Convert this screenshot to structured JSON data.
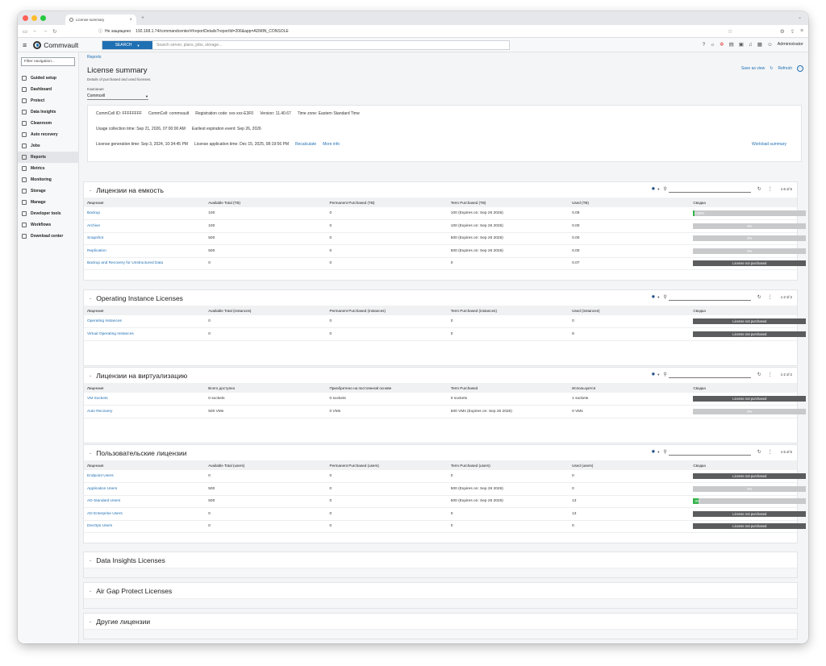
{
  "browser": {
    "tab_title": "License summary",
    "not_secure": "Не защищено",
    "url": "192.168.1.74/commandcenter/#/reportDetails?reportId=206&app=ADMIN_CONSOLE"
  },
  "header": {
    "logo": "Commvault",
    "search_button": "SEARCH",
    "search_placeholder": "Search server, plans, jobs, storage...",
    "user": "Administrator"
  },
  "sidebar": {
    "filter_placeholder": "Filter navigation...",
    "items": [
      {
        "label": "Guided setup",
        "icon": "compass-icon"
      },
      {
        "label": "Dashboard",
        "icon": "grid-icon"
      },
      {
        "label": "Protect",
        "icon": "checklist-icon"
      },
      {
        "label": "Data Insights",
        "icon": "insights-icon"
      },
      {
        "label": "Cleanroom",
        "icon": "cleanroom-icon"
      },
      {
        "label": "Auto recovery",
        "icon": "recovery-icon"
      },
      {
        "label": "Jobs",
        "icon": "jobs-icon"
      },
      {
        "label": "Reports",
        "icon": "reports-icon"
      },
      {
        "label": "Metrics",
        "icon": "metrics-icon"
      },
      {
        "label": "Monitoring",
        "icon": "monitoring-icon"
      },
      {
        "label": "Storage",
        "icon": "storage-icon"
      },
      {
        "label": "Manage",
        "icon": "manage-icon"
      },
      {
        "label": "Developer tools",
        "icon": "developer-icon"
      },
      {
        "label": "Workflows",
        "icon": "workflow-icon"
      },
      {
        "label": "Download center",
        "icon": "download-icon"
      }
    ]
  },
  "page": {
    "breadcrumb": "Reports",
    "title": "License summary",
    "subtitle": "Details of purchased and used licenses.",
    "save_as_view": "Save as view",
    "refresh": "Refresh",
    "company_label": "Компания",
    "company_value": "Commcell"
  },
  "info": {
    "row1": [
      "CommCell ID: FFFFFFFF",
      "CommCell: commvault",
      "Registration code: xxx-xxx-E3F0",
      "Version: 11.40.67",
      "Time zone: Eastern Standard Time"
    ],
    "row2": [
      "Usage collection time: Sep 21, 2026, 07:00:00 AM",
      "Earliest expiration event: Sep 26, 2026"
    ],
    "row3": [
      "License generation time: Sep 3, 2024, 10:34:45 PM",
      "License application time: Dec 15, 2025, 08:19:56 PM"
    ],
    "recalculate": "Recalculate",
    "more_info": "More info",
    "workload_summary": "Workload summary"
  },
  "sections": [
    {
      "title": "Лицензии на емкость",
      "count": "1-5 of 5",
      "columns": [
        "Лицензия",
        "Available Total (TB)",
        "Permanent Purchased (TB)",
        "Term Purchased (TB)",
        "Used (TB)",
        "Сводка"
      ],
      "rows": [
        {
          "cells": [
            "Backup",
            "100",
            "0",
            "100 (Expires on: Sep 26 2026)",
            "0.09"
          ],
          "summary": "0.09%",
          "fill": 0.0009,
          "np": false
        },
        {
          "cells": [
            "Archive",
            "100",
            "0",
            "100 (Expires on: Sep 26 2026)",
            "0.00"
          ],
          "summary": "0%",
          "fill": 0,
          "np": false
        },
        {
          "cells": [
            "Snapshot",
            "500",
            "0",
            "500 (Expires on: Sep 26 2026)",
            "0.00"
          ],
          "summary": "0%",
          "fill": 0,
          "np": false
        },
        {
          "cells": [
            "Replication",
            "500",
            "0",
            "500 (Expires on: Sep 26 2026)",
            "0.00"
          ],
          "summary": "0%",
          "fill": 0,
          "np": false
        },
        {
          "cells": [
            "Backup and Recovery for Unstructured Data",
            "0",
            "0",
            "0",
            "0.07"
          ],
          "summary": "License not purchased",
          "fill": 0,
          "np": true
        }
      ]
    },
    {
      "title": "Operating Instance Licenses",
      "count": "1-2 of 2",
      "columns": [
        "Лицензия",
        "Available Total (instances)",
        "Permanent Purchased (instances)",
        "Term Purchased (instances)",
        "Used (instances)",
        "Сводка"
      ],
      "rows": [
        {
          "cells": [
            "Operating Instances",
            "0",
            "0",
            "0",
            "0"
          ],
          "summary": "License not purchased",
          "fill": 0,
          "np": true
        },
        {
          "cells": [
            "Virtual Operating Instances",
            "0",
            "0",
            "0",
            "8"
          ],
          "summary": "License not purchased",
          "fill": 0,
          "np": true
        }
      ]
    },
    {
      "title": "Лицензии на виртуализацию",
      "count": "1-2 of 2",
      "columns": [
        "Лицензия",
        "Всего доступно",
        "Приобретено на постоянной основе",
        "Term Purchased",
        "Используется",
        "Сводка"
      ],
      "rows": [
        {
          "cells": [
            "VM Sockets",
            "0 sockets",
            "0 sockets",
            "0 sockets",
            "1 sockets"
          ],
          "summary": "License not purchased",
          "fill": 0,
          "np": true
        },
        {
          "cells": [
            "Auto Recovery",
            "500 VMs",
            "0 VMs",
            "500 VMs (Expires on: Sep 26 2026)",
            "0 VMs"
          ],
          "summary": "0%",
          "fill": 0,
          "np": false
        }
      ]
    },
    {
      "title": "Пользовательские лицензии",
      "count": "1-5 of 5",
      "columns": [
        "Лицензия",
        "Available Total (users)",
        "Permanent Purchased (users)",
        "Term Purchased (users)",
        "Used (users)",
        "Сводка"
      ],
      "rows": [
        {
          "cells": [
            "Endpoint Users",
            "0",
            "0",
            "0",
            "0"
          ],
          "summary": "License not purchased",
          "fill": 0,
          "np": true
        },
        {
          "cells": [
            "Application Users",
            "500",
            "0",
            "500 (Expires on: Sep 26 2026)",
            "0"
          ],
          "summary": "0%",
          "fill": 0,
          "np": false
        },
        {
          "cells": [
            "AD Standard Users",
            "500",
            "0",
            "500 (Expires on: Sep 26 2026)",
            "13"
          ],
          "summary": "3%",
          "fill": 0.026,
          "np": false
        },
        {
          "cells": [
            "AD Enterprise Users",
            "0",
            "0",
            "0",
            "13"
          ],
          "summary": "License not purchased",
          "fill": 0,
          "np": true
        },
        {
          "cells": [
            "DevOps Users",
            "0",
            "0",
            "0",
            "0"
          ],
          "summary": "License not purchased",
          "fill": 0,
          "np": true
        }
      ]
    }
  ],
  "collapsed_sections": [
    "Data Insights Licenses",
    "Air Gap Protect Licenses",
    "Другие лицензии"
  ]
}
